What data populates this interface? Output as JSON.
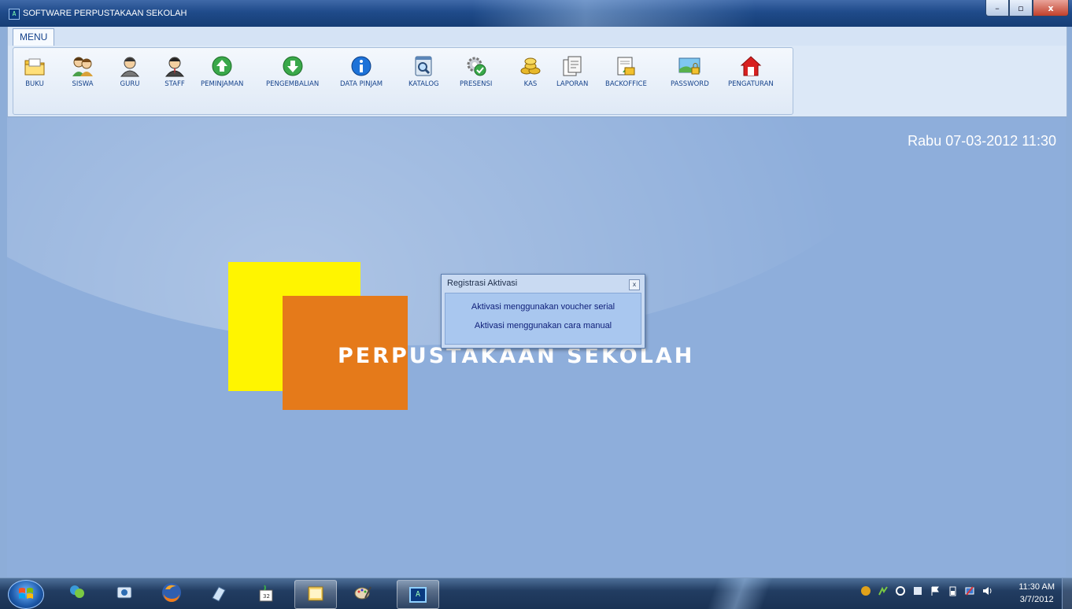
{
  "window": {
    "title": "SOFTWARE PERPUSTAKAAN SEKOLAH",
    "app_icon_letter": "A",
    "min_glyph": "–",
    "max_glyph": "▫",
    "close_glyph": "x"
  },
  "ribbon": {
    "tab": "MENU",
    "tools": [
      {
        "label": "BUKU",
        "icon": "folder-icon"
      },
      {
        "label": "SISWA",
        "icon": "students-icon"
      },
      {
        "label": "GURU",
        "icon": "teacher-icon"
      },
      {
        "label": "STAFF",
        "icon": "staff-icon"
      },
      {
        "label": "PEMINJAMAN",
        "icon": "arrow-up-circle-icon"
      },
      {
        "label": "PENGEMBALIAN",
        "icon": "arrow-down-circle-icon"
      },
      {
        "label": "DATA PINJAM",
        "icon": "info-icon"
      },
      {
        "label": "KATALOG",
        "icon": "catalog-search-icon"
      },
      {
        "label": "PRESENSI",
        "icon": "attendance-gear-icon"
      },
      {
        "label": "KAS",
        "icon": "coins-icon"
      },
      {
        "label": "LAPORAN",
        "icon": "report-icon"
      },
      {
        "label": "BACKOFFICE",
        "icon": "backoffice-icon"
      },
      {
        "label": "PASSWORD",
        "icon": "password-lock-icon"
      },
      {
        "label": "PENGATURAN",
        "icon": "home-settings-icon"
      }
    ]
  },
  "main": {
    "datetime": "Rabu  07-03-2012  11:30",
    "banner_title": "PERPUSTAKAAN SEKOLAH"
  },
  "dialog": {
    "title": "Registrasi Aktivasi",
    "close_glyph": "x",
    "option_voucher": "Aktivasi menggunakan voucher serial",
    "option_manual": "Aktivasi menggunakan cara manual"
  },
  "taskbar": {
    "clock_time": "11:30 AM",
    "clock_date": "3/7/2012",
    "active_app_letter": "A",
    "calendar_badge": "32"
  },
  "colors": {
    "desktop": "#8eaedb",
    "yellow": "#fff500",
    "orange": "#e57a1a",
    "ribbon_text": "#15428b"
  }
}
